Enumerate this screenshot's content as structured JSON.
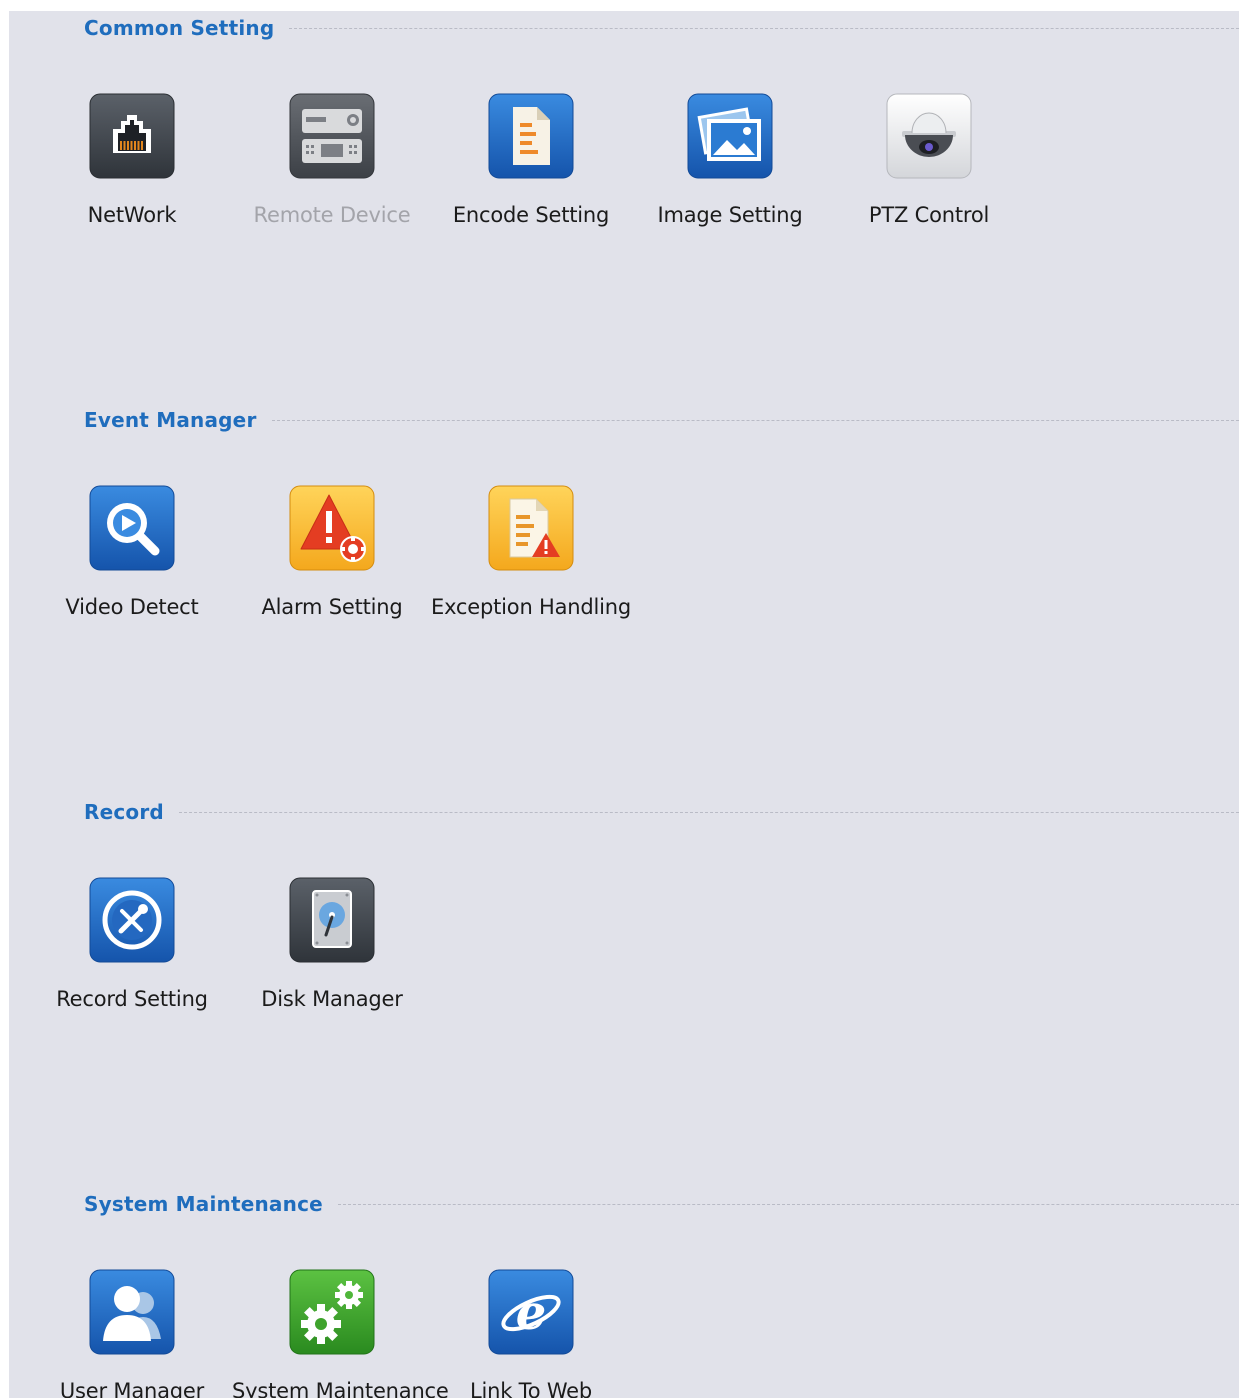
{
  "sections": [
    {
      "title": "Common Setting",
      "items": [
        {
          "label": "NetWork",
          "icon": "network-icon",
          "enabled": true
        },
        {
          "label": "Remote Device",
          "icon": "remote-device-icon",
          "enabled": false
        },
        {
          "label": "Encode Setting",
          "icon": "encode-setting-icon",
          "enabled": true
        },
        {
          "label": "Image Setting",
          "icon": "image-setting-icon",
          "enabled": true
        },
        {
          "label": "PTZ Control",
          "icon": "ptz-camera-icon",
          "enabled": true
        }
      ]
    },
    {
      "title": "Event Manager",
      "items": [
        {
          "label": "Video Detect",
          "icon": "video-detect-icon",
          "enabled": true
        },
        {
          "label": "Alarm Setting",
          "icon": "alarm-setting-icon",
          "enabled": true
        },
        {
          "label": "Exception Handling",
          "icon": "exception-handling-icon",
          "enabled": true
        }
      ]
    },
    {
      "title": "Record",
      "items": [
        {
          "label": "Record Setting",
          "icon": "record-setting-icon",
          "enabled": true
        },
        {
          "label": "Disk Manager",
          "icon": "disk-manager-icon",
          "enabled": true
        }
      ]
    },
    {
      "title": "System Maintenance",
      "items": [
        {
          "label": "User Manager",
          "icon": "user-manager-icon",
          "enabled": true
        },
        {
          "label": "System Maintenance",
          "icon": "system-maintenance-icon",
          "enabled": true
        },
        {
          "label": "Link To Web",
          "icon": "web-browser-icon",
          "enabled": true
        }
      ]
    }
  ],
  "colors": {
    "section_title": "#1f6dbd",
    "panel_background": "#e1e2ea",
    "label_text": "#1b1b1b",
    "disabled_label_text": "#a3a4aa"
  }
}
